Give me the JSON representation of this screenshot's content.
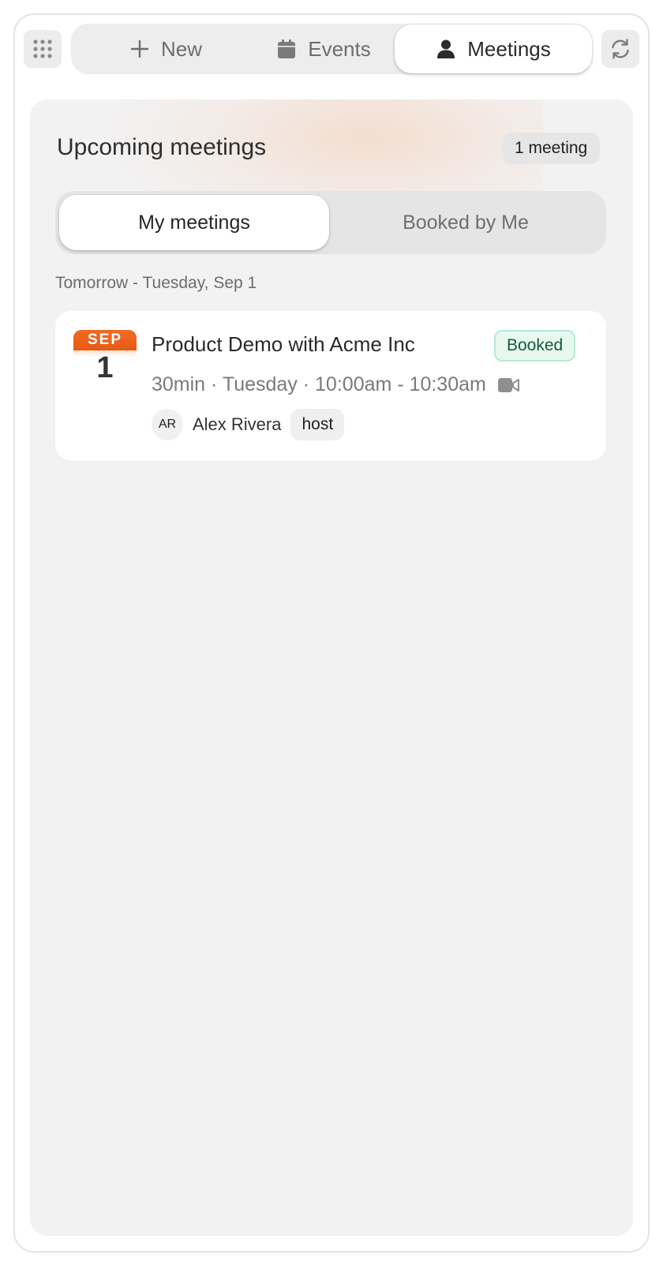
{
  "topbar": {
    "apps_icon": "grid-icon",
    "refresh_icon": "refresh-icon",
    "tabs": [
      {
        "label": "New",
        "icon": "plus-icon",
        "active": false
      },
      {
        "label": "Events",
        "icon": "calendar-icon",
        "active": false
      },
      {
        "label": "Meetings",
        "icon": "person-icon",
        "active": true
      }
    ]
  },
  "panel": {
    "title": "Upcoming meetings",
    "count_badge": "1 meeting",
    "segments": [
      {
        "label": "My meetings",
        "active": true
      },
      {
        "label": "Booked by Me",
        "active": false
      }
    ],
    "groups": [
      {
        "heading": "Tomorrow - Tuesday, Sep 1",
        "meetings": [
          {
            "month": "SEP",
            "day": "1",
            "title": "Product Demo with Acme Inc",
            "status": "Booked",
            "meta": "30min · Tuesday · 10:00am - 10:30am",
            "video_icon": "video-camera-icon",
            "host": {
              "initials": "AR",
              "name": "Alex Rivera",
              "role": "host"
            }
          }
        ]
      }
    ]
  },
  "colors": {
    "accent_orange": "#f26a24",
    "status_green_bg": "#e8f8f1",
    "status_green_text": "#16583c",
    "panel_bg": "#f2f2f2"
  }
}
